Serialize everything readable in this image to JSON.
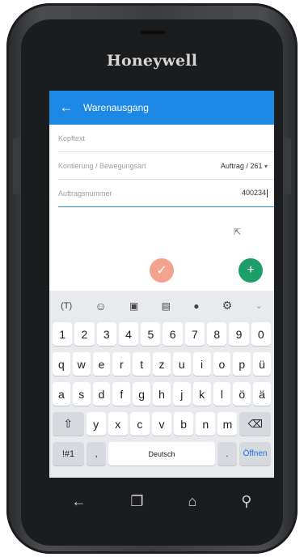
{
  "device": {
    "brand": "Honeywell"
  },
  "appbar": {
    "back_icon": "arrow-left-icon",
    "title": "Warenausgang",
    "color": "#1e88e5"
  },
  "form": {
    "kopftext_label": "Kopftext",
    "kontierung_label": "Kontierung / Bewegungsart",
    "kontierung_value": "Auftrag / 261",
    "auftragsnummer_label": "Auftragsnummer",
    "auftragsnummer_value": "400234"
  },
  "actions": {
    "confirm_color": "#f4a48e",
    "add_color": "#1e9e6b",
    "add_label": "+",
    "confirm_label": "✓"
  },
  "keyboard": {
    "toolbar": [
      "text-transform-icon",
      "emoji-icon",
      "sticker-icon",
      "gif-icon",
      "microphone-icon",
      "settings-icon",
      "chevron-down-icon"
    ],
    "numbers": [
      "1",
      "2",
      "3",
      "4",
      "5",
      "6",
      "7",
      "8",
      "9",
      "0"
    ],
    "row1": [
      "q",
      "w",
      "e",
      "r",
      "t",
      "z",
      "u",
      "i",
      "o",
      "p",
      "ü"
    ],
    "row2": [
      "a",
      "s",
      "d",
      "f",
      "g",
      "h",
      "j",
      "k",
      "l",
      "ö",
      "ä"
    ],
    "row3": [
      "y",
      "x",
      "c",
      "v",
      "b",
      "n",
      "m"
    ],
    "symbols_label": "!#1",
    "comma": ",",
    "space_label": "Deutsch",
    "period": ".",
    "enter_label": "Öffnen"
  },
  "navbar": [
    "back-icon",
    "recents-icon",
    "home-icon",
    "search-icon"
  ]
}
